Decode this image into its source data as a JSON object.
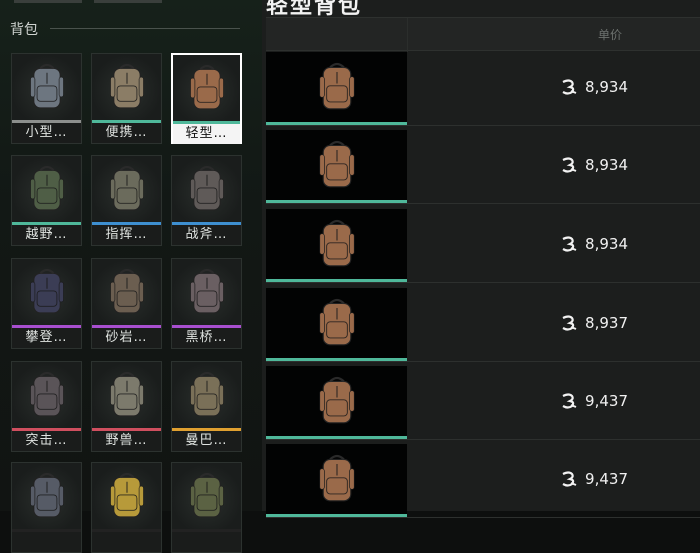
{
  "left_panel": {
    "section_title": "背包",
    "items": [
      {
        "label": "小型…",
        "rarity_color": "#8c8f8d",
        "tint": "#6d7680",
        "selected": false
      },
      {
        "label": "便携…",
        "rarity_color": "#4fb89a",
        "tint": "#8b7d66",
        "selected": false
      },
      {
        "label": "轻型…",
        "rarity_color": "#4fb89a",
        "tint": "#9a6a4a",
        "selected": true
      },
      {
        "label": "越野…",
        "rarity_color": "#4fb89a",
        "tint": "#4f5e46",
        "selected": false
      },
      {
        "label": "指挥…",
        "rarity_color": "#3e8fd0",
        "tint": "#6b6b5c",
        "selected": false
      },
      {
        "label": "战斧…",
        "rarity_color": "#3e8fd0",
        "tint": "#5f5a58",
        "selected": false
      },
      {
        "label": "攀登…",
        "rarity_color": "#a84fcf",
        "tint": "#3b3d55",
        "selected": false
      },
      {
        "label": "砂岩…",
        "rarity_color": "#a84fcf",
        "tint": "#6b5e50",
        "selected": false
      },
      {
        "label": "黑桥…",
        "rarity_color": "#a84fcf",
        "tint": "#6a5f62",
        "selected": false
      },
      {
        "label": "突击…",
        "rarity_color": "#d04f5f",
        "tint": "#5a5458",
        "selected": false
      },
      {
        "label": "野兽…",
        "rarity_color": "#d04f5f",
        "tint": "#7c7a6c",
        "selected": false
      },
      {
        "label": "曼巴…",
        "rarity_color": "#e0a030",
        "tint": "#7a7058",
        "selected": false
      },
      {
        "label": "",
        "rarity_color": "#222",
        "tint": "#565b66",
        "selected": false
      },
      {
        "label": "",
        "rarity_color": "#222",
        "tint": "#b79a3a",
        "selected": false
      },
      {
        "label": "",
        "rarity_color": "#222",
        "tint": "#5b6243",
        "selected": false
      }
    ]
  },
  "right_panel": {
    "title": "轻型背包",
    "price_header": "单价",
    "listings": [
      {
        "price": "8,934"
      },
      {
        "price": "8,934"
      },
      {
        "price": "8,934"
      },
      {
        "price": "8,937"
      },
      {
        "price": "9,437"
      },
      {
        "price": "9,437"
      }
    ],
    "rarity_color": "#4fb89a",
    "item_tint": "#9a6a4a"
  }
}
